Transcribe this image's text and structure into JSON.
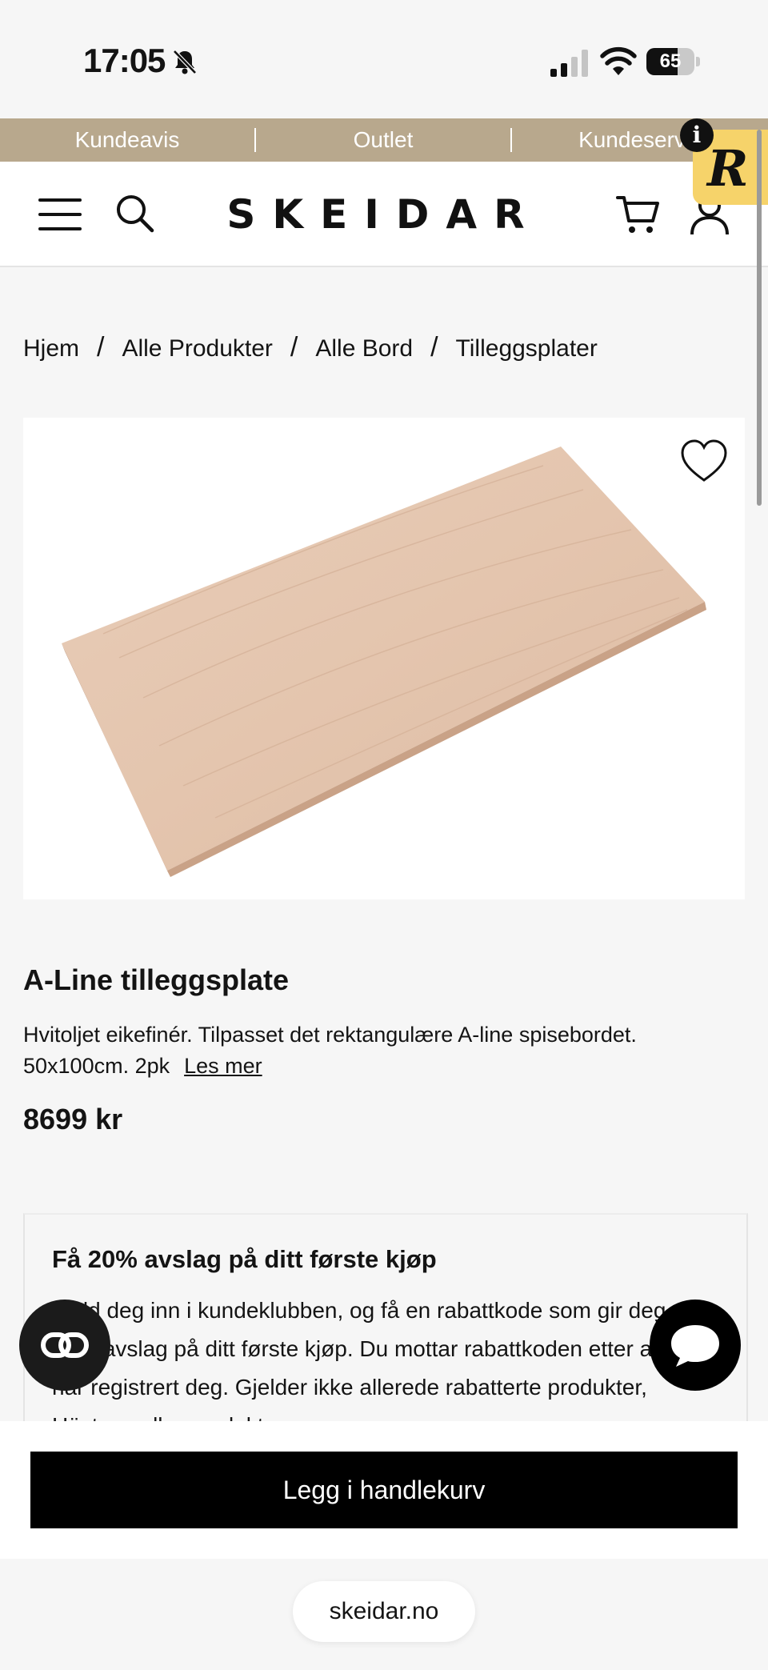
{
  "status_bar": {
    "time": "17:05",
    "battery": "65",
    "battery_level": 0.65
  },
  "promo_strip": {
    "items": [
      "Kundeavis",
      "Outlet",
      "Kundeserv"
    ]
  },
  "header": {
    "logo": "SKEIDAR"
  },
  "badge": {
    "letter": "R",
    "info": "i"
  },
  "breadcrumb": [
    "Hjem",
    "Alle Produkter",
    "Alle Bord",
    "Tilleggsplater"
  ],
  "breadcrumb_sep": "/",
  "product": {
    "title": "A-Line tilleggsplate",
    "description": "Hvitoljet eikefinér. Tilpasset det rektangulære A-line spisebordet. 50x100cm. 2pk",
    "read_more": "Les mer",
    "price": "8699 kr"
  },
  "offer": {
    "title": "Få 20% avslag på ditt første kjøp",
    "text": "Meld deg inn i kundeklubben, og få en rabattkode som gir deg 20% avslag på ditt første kjøp. Du mottar rabattkoden etter at du har registrert deg. Gjelder ikke allerede rabatterte produkter, Hästens eller produkter"
  },
  "cta": {
    "add_to_cart": "Legg i handlekurv"
  },
  "browser": {
    "url": "skeidar.no"
  },
  "colors": {
    "accent": "#b8a88d",
    "badge": "#f6d36a",
    "button": "#000000"
  },
  "icons": [
    "bell-slash-icon",
    "signal-icon",
    "wifi-icon",
    "battery-icon",
    "menu-icon",
    "search-icon",
    "cart-icon",
    "account-icon",
    "heart-icon",
    "ar-icon",
    "chat-icon"
  ]
}
